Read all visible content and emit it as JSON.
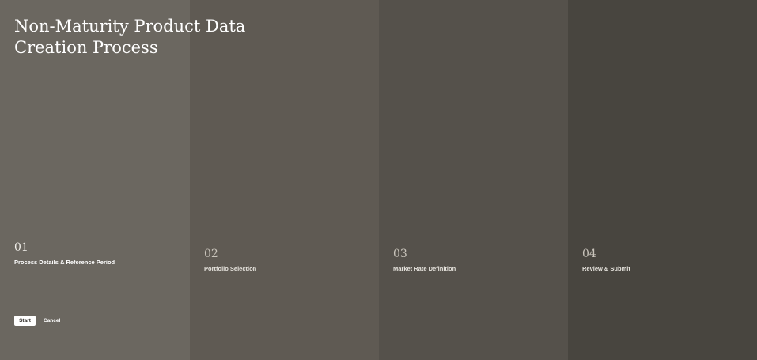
{
  "page": {
    "title": "Non-Maturity Product Data Creation Process"
  },
  "steps": [
    {
      "number": "01",
      "label": "Process Details & Reference Period"
    },
    {
      "number": "02",
      "label": "Portfolio Selection"
    },
    {
      "number": "03",
      "label": "Market Rate Definition"
    },
    {
      "number": "04",
      "label": "Review & Submit"
    }
  ],
  "actions": {
    "start_label": "Start",
    "cancel_label": "Cancel"
  },
  "colors": {
    "panel_1": "#6b6760",
    "panel_2": "#5f5a53",
    "panel_3": "#55514b",
    "panel_4": "#48453f",
    "text": "#ffffff"
  }
}
